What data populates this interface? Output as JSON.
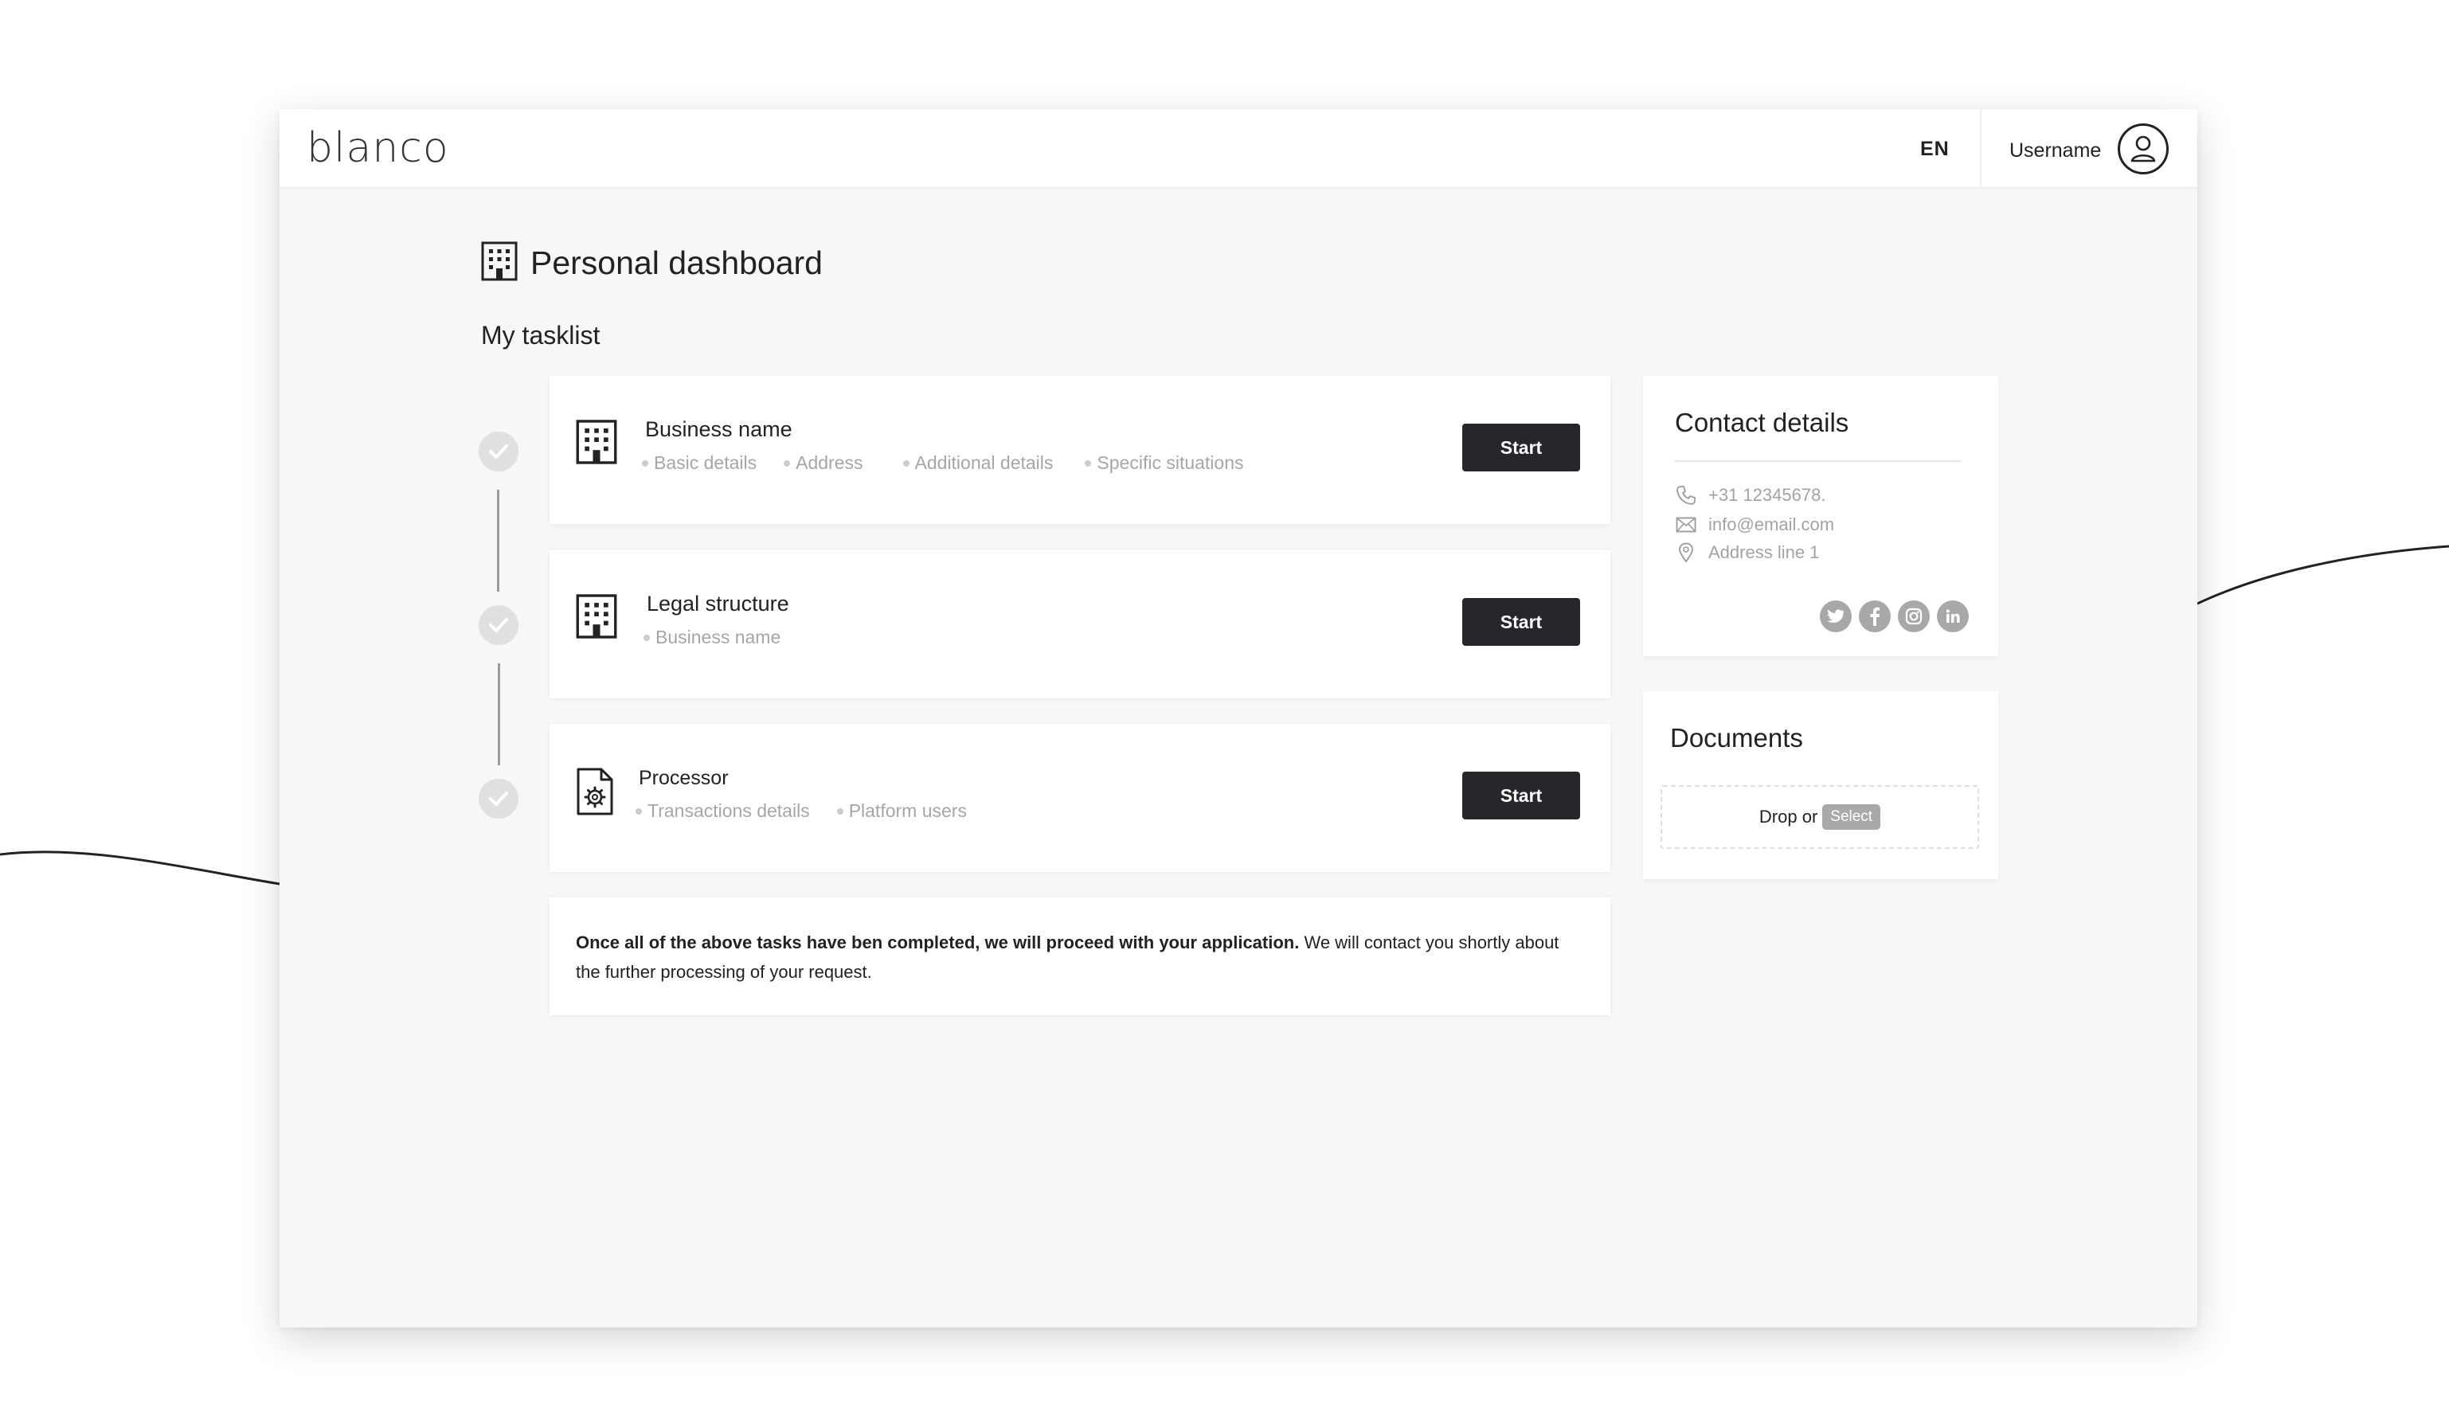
{
  "header": {
    "logo_text": "blanco",
    "language": "EN",
    "username": "Username"
  },
  "page": {
    "title": "Personal dashboard",
    "tasklist_heading": "My tasklist"
  },
  "tasks": [
    {
      "title": "Business name",
      "items": [
        "Basic details",
        "Address",
        "Additional details",
        "Specific situations"
      ],
      "button": "Start",
      "icon": "building-icon",
      "completed": true
    },
    {
      "title": "Legal structure",
      "items": [
        "Business name"
      ],
      "button": "Start",
      "icon": "building-icon",
      "completed": true
    },
    {
      "title": "Processor",
      "items": [
        "Transactions details",
        "Platform users"
      ],
      "button": "Start",
      "icon": "document-gear-icon",
      "completed": true
    }
  ],
  "note": {
    "bold": "Once all of the above tasks have ben completed, we will proceed with your application.",
    "text": " We will contact you shortly about the further processing of your request."
  },
  "contact": {
    "title": "Contact details",
    "phone": "+31 12345678.",
    "email": "info@email.com",
    "address": "Address line 1",
    "socials": [
      "twitter-icon",
      "facebook-icon",
      "instagram-icon",
      "linkedin-icon"
    ]
  },
  "documents": {
    "title": "Documents",
    "drop_text": "Drop or",
    "select_label": "Select"
  },
  "colors": {
    "primary_button": "#26262b",
    "background": "#f7f7f7",
    "muted_text": "#a6a6a6"
  }
}
